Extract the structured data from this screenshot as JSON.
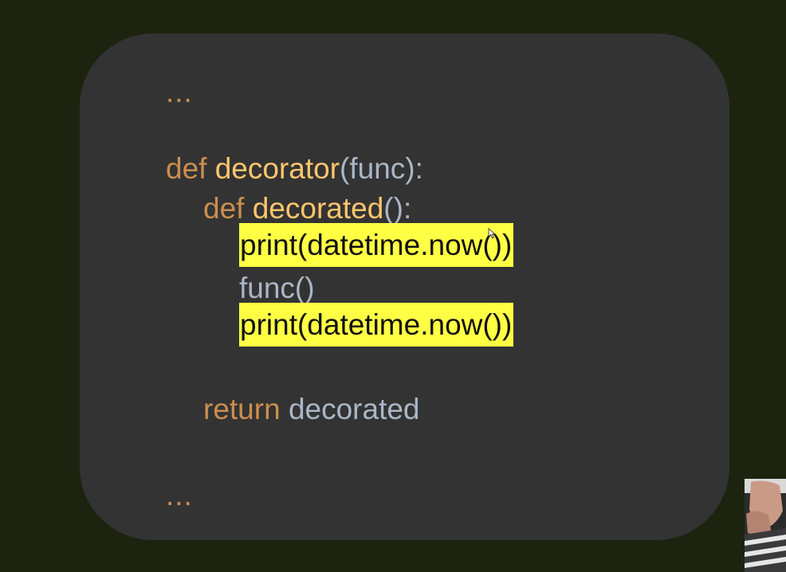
{
  "slide": {
    "lines": [
      {
        "id": "ellipsis_top",
        "text": "..."
      },
      {
        "id": "def_decorator",
        "keyword": "def",
        "name": "decorator",
        "rest": "(func):"
      },
      {
        "id": "def_decorated",
        "keyword": "def",
        "name": "decorated",
        "rest": "():"
      },
      {
        "id": "print_1",
        "text": "print(datetime.now())",
        "highlighted": true
      },
      {
        "id": "func_call",
        "text": "func()"
      },
      {
        "id": "print_2",
        "text": "print(datetime.now())",
        "highlighted": true
      },
      {
        "id": "return_line",
        "keyword": "return",
        "rest": "decorated"
      },
      {
        "id": "ellipsis_bottom",
        "text": "..."
      }
    ]
  },
  "colors": {
    "page_background": "#1c2410",
    "card_background": "#333333",
    "keyword": "#cc8e4f",
    "function_name": "#ffc66d",
    "plain_text": "#a9b7c6",
    "highlight": "#ffff44"
  },
  "icons": {
    "cursor": "mouse-pointer-icon"
  }
}
